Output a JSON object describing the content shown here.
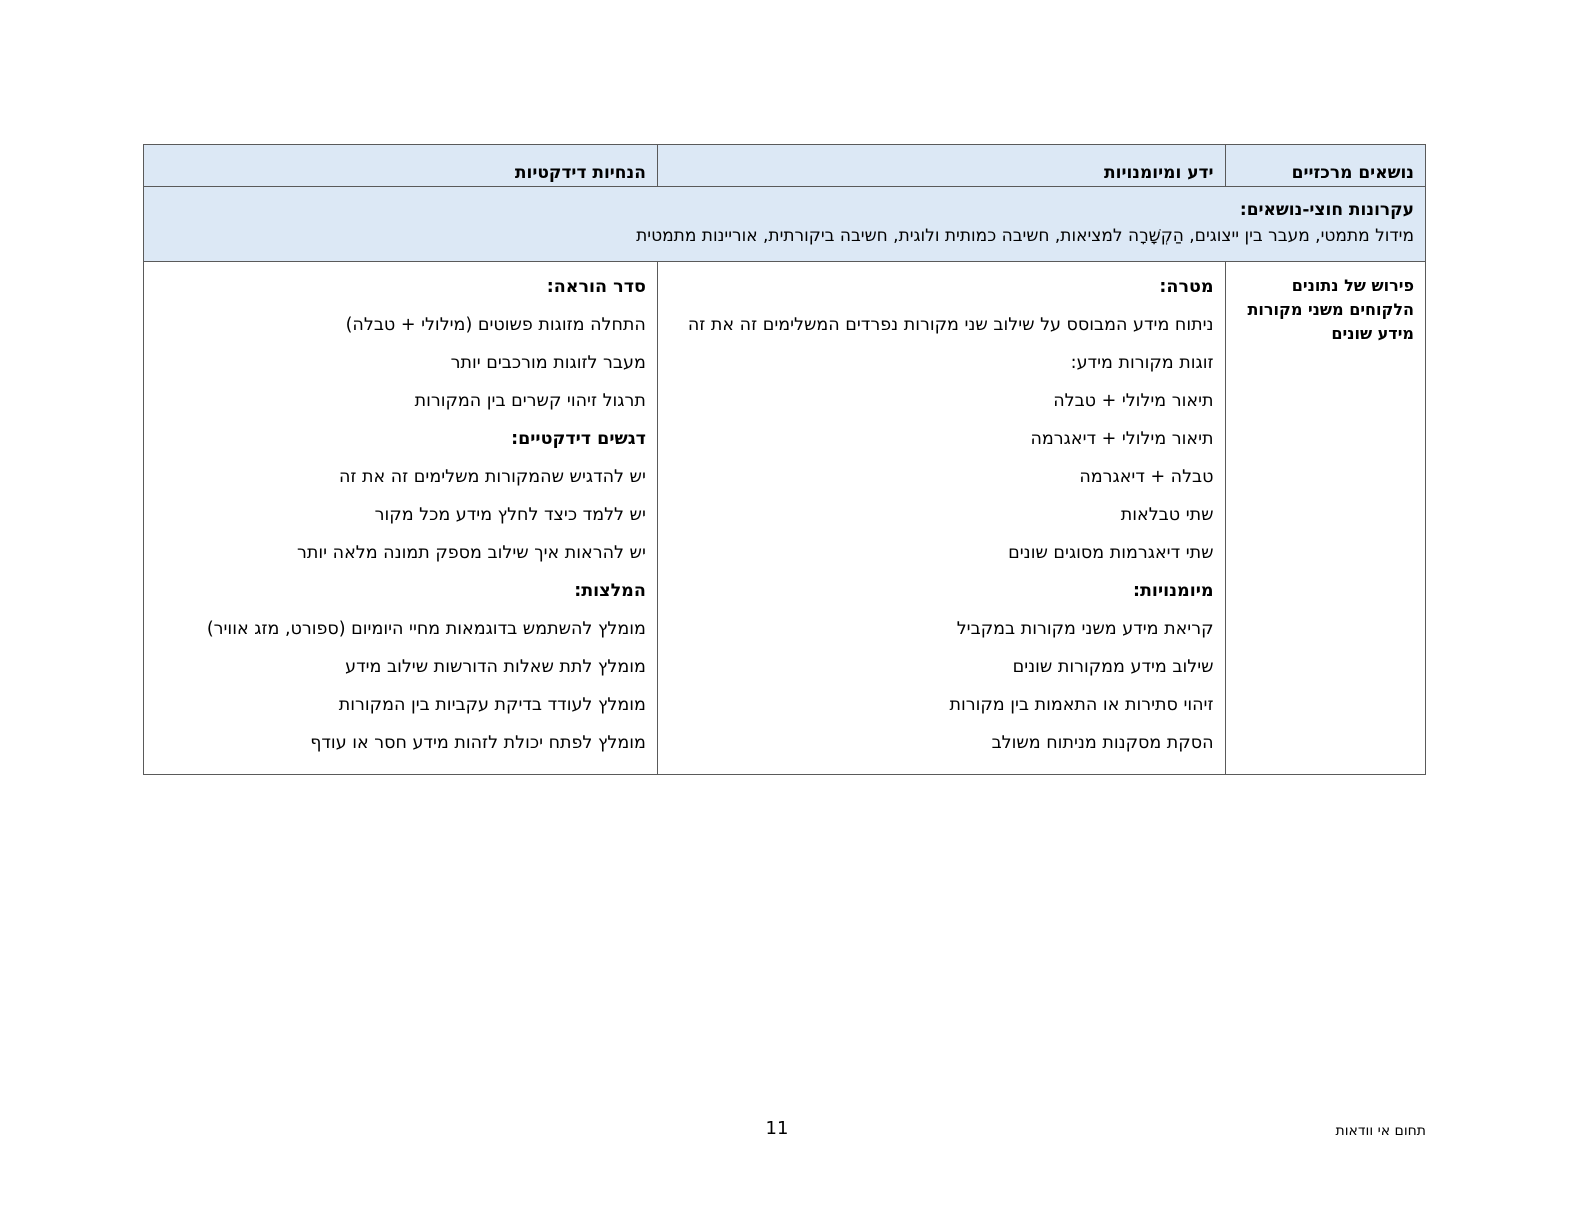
{
  "table": {
    "headers": {
      "topics": "נושאים מרכזיים",
      "knowledge": "ידע ומיומנויות",
      "guidelines": "הנחיות דידקטיות"
    },
    "cross_topic": {
      "title": "עקרונות חוצי-נושאים:",
      "text": "מידול מתמטי, מעבר בין ייצוגים, הַקְשָׁרָה למציאות, חשיבה כמותית ולוגית, חשיבה ביקורתית, אוריינות מתמטית"
    },
    "row": {
      "topic": "פירוש של נתונים הלקוחים משני מקורות מידע שונים",
      "knowledge": [
        {
          "text": "מטרה:",
          "bold": true
        },
        {
          "text": "ניתוח מידע המבוסס על שילוב שני מקורות נפרדים המשלימים זה את זה",
          "bold": false
        },
        {
          "text": "זוגות מקורות מידע:",
          "bold": false
        },
        {
          "text": "תיאור מילולי + טבלה",
          "bold": false
        },
        {
          "text": "תיאור מילולי + דיאגרמה",
          "bold": false
        },
        {
          "text": "טבלה + דיאגרמה",
          "bold": false
        },
        {
          "text": "שתי טבלאות",
          "bold": false
        },
        {
          "text": "שתי דיאגרמות מסוגים שונים",
          "bold": false
        },
        {
          "text": "מיומנויות:",
          "bold": true
        },
        {
          "text": "קריאת מידע משני מקורות במקביל",
          "bold": false
        },
        {
          "text": "שילוב מידע ממקורות שונים",
          "bold": false
        },
        {
          "text": "זיהוי סתירות או התאמות בין מקורות",
          "bold": false
        },
        {
          "text": "הסקת מסקנות מניתוח משולב",
          "bold": false
        }
      ],
      "guidelines": [
        {
          "text": "סדר הוראה:",
          "bold": true
        },
        {
          "text": "התחלה מזוגות פשוטים (מילולי + טבלה)",
          "bold": false
        },
        {
          "text": "מעבר לזוגות מורכבים יותר",
          "bold": false
        },
        {
          "text": "תרגול זיהוי קשרים בין המקורות",
          "bold": false
        },
        {
          "text": "דגשים דידקטיים:",
          "bold": true
        },
        {
          "text": "יש להדגיש שהמקורות משלימים זה את זה",
          "bold": false
        },
        {
          "text": "יש ללמד כיצד לחלץ מידע מכל מקור",
          "bold": false
        },
        {
          "text": "יש להראות איך שילוב מספק תמונה מלאה יותר",
          "bold": false
        },
        {
          "text": "המלצות:",
          "bold": true
        },
        {
          "text": "מומלץ להשתמש בדוגמאות מחיי היומיום (ספורט, מזג אוויר)",
          "bold": false
        },
        {
          "text": "מומלץ לתת שאלות הדורשות שילוב מידע",
          "bold": false
        },
        {
          "text": "מומלץ לעודד בדיקת עקביות בין המקורות",
          "bold": false
        },
        {
          "text": "מומלץ לפתח יכולת לזהות מידע חסר או עודף",
          "bold": false
        }
      ]
    }
  },
  "footer": {
    "page_number": "11",
    "section": "תחום אי וודאות"
  },
  "colors": {
    "header_bg": "#dce8f5",
    "border": "#5a5a5a"
  }
}
